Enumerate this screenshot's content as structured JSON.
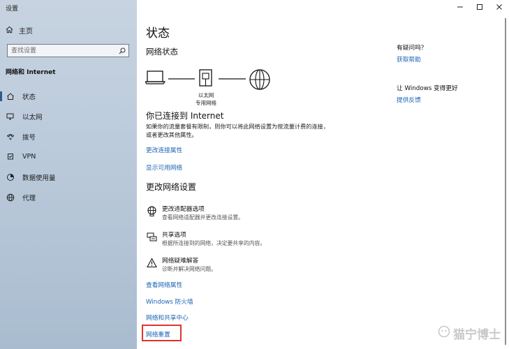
{
  "window": {
    "title": "设置"
  },
  "sidebar": {
    "home_label": "主页",
    "search_placeholder": "查找设置",
    "section_heading": "网络和 Internet",
    "items": [
      {
        "label": "状态",
        "icon": "house-status-icon",
        "active": true
      },
      {
        "label": "以太网",
        "icon": "monitor-icon",
        "active": false
      },
      {
        "label": "拨号",
        "icon": "phone-icon",
        "active": false
      },
      {
        "label": "VPN",
        "icon": "vpn-icon",
        "active": false
      },
      {
        "label": "数据使用量",
        "icon": "gauge-icon",
        "active": false
      },
      {
        "label": "代理",
        "icon": "globe-icon",
        "active": false
      }
    ]
  },
  "main": {
    "title": "状态",
    "status_heading": "网络状态",
    "diagram": {
      "adapter_label_1": "以太网",
      "adapter_label_2": "专用网络"
    },
    "connection_title": "你已连接到 Internet",
    "connection_desc": "如果你的流量套餐有限制，则你可以将此网络设置为按流量计费的连接，或者更改其他属性。",
    "link_change_props": "更改连接属性",
    "link_show_networks": "显示可用网络",
    "change_heading": "更改网络设置",
    "options": [
      {
        "title": "更改适配器选项",
        "desc": "查看网络适配器并更改连接设置。",
        "icon": "globe-adapter-icon"
      },
      {
        "title": "共享选项",
        "desc": "根据所连接到的网络，决定要共享的内容。",
        "icon": "share-printer-icon"
      },
      {
        "title": "网络疑难解答",
        "desc": "诊断并解决网络问题。",
        "icon": "warning-icon"
      }
    ],
    "links": {
      "hardware_props": "查看网络属性",
      "firewall": "Windows 防火墙",
      "sharing_center": "网络和共享中心",
      "reset": "网络重置"
    }
  },
  "right": {
    "question_title": "有疑问吗？",
    "help_link": "获取帮助",
    "improve_title": "让 Windows 变得更好",
    "feedback_link": "提供反馈"
  },
  "watermark": {
    "text": "猫宁博士"
  },
  "colors": {
    "accent": "#1a65b5",
    "sidebar_bg": "#bccbdc",
    "highlight_red": "#e3312d"
  }
}
